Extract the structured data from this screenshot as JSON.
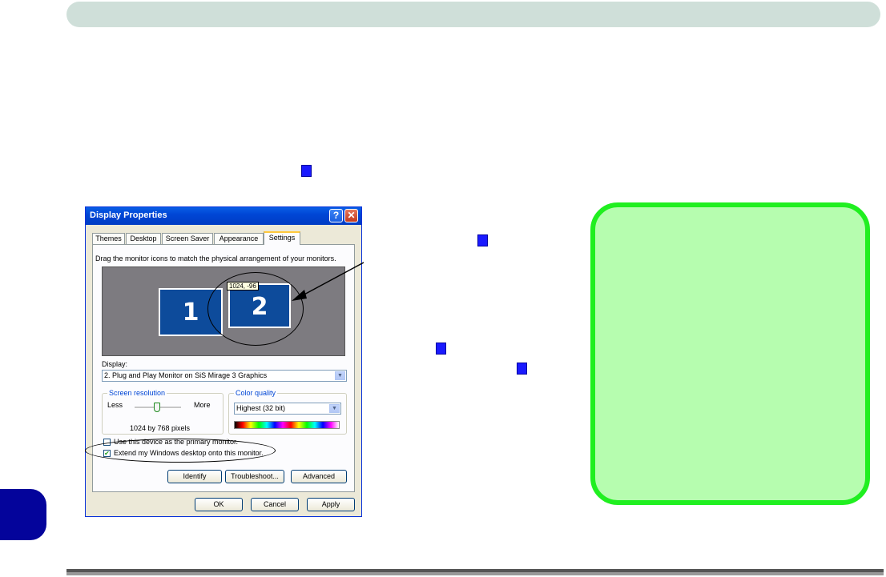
{
  "dialog": {
    "title": "Display Properties",
    "help_button": "?",
    "close_button": "✕",
    "tabs": [
      "Themes",
      "Desktop",
      "Screen Saver",
      "Appearance",
      "Settings"
    ],
    "active_tab": "Settings",
    "instruction": "Drag the monitor icons to match the physical arrangement of your monitors.",
    "monitors": {
      "monitor1_label": "1",
      "monitor2_label": "2",
      "tooltip": "1024, -96"
    },
    "display_label": "Display:",
    "display_value": "2. Plug and Play Monitor on SiS Mirage 3 Graphics",
    "screen_resolution": {
      "label": "Screen resolution",
      "less": "Less",
      "more": "More",
      "value": "1024 by 768 pixels"
    },
    "color_quality": {
      "label": "Color quality",
      "value": "Highest (32 bit)"
    },
    "checkboxes": [
      {
        "label": "Use this device as the primary monitor.",
        "checked": false
      },
      {
        "label": "Extend my Windows desktop onto this monitor.",
        "checked": true
      }
    ],
    "buttons": {
      "identify": "Identify",
      "troubleshoot": "Troubleshoot...",
      "advanced": "Advanced",
      "ok": "OK",
      "cancel": "Cancel",
      "apply": "Apply"
    }
  },
  "colors": {
    "marker": "#1a1aff",
    "green_box_fill": "#b6fdaf",
    "green_box_border": "#20ef20",
    "side_tab": "#04049b",
    "top_bar": "#cfdfd9"
  }
}
